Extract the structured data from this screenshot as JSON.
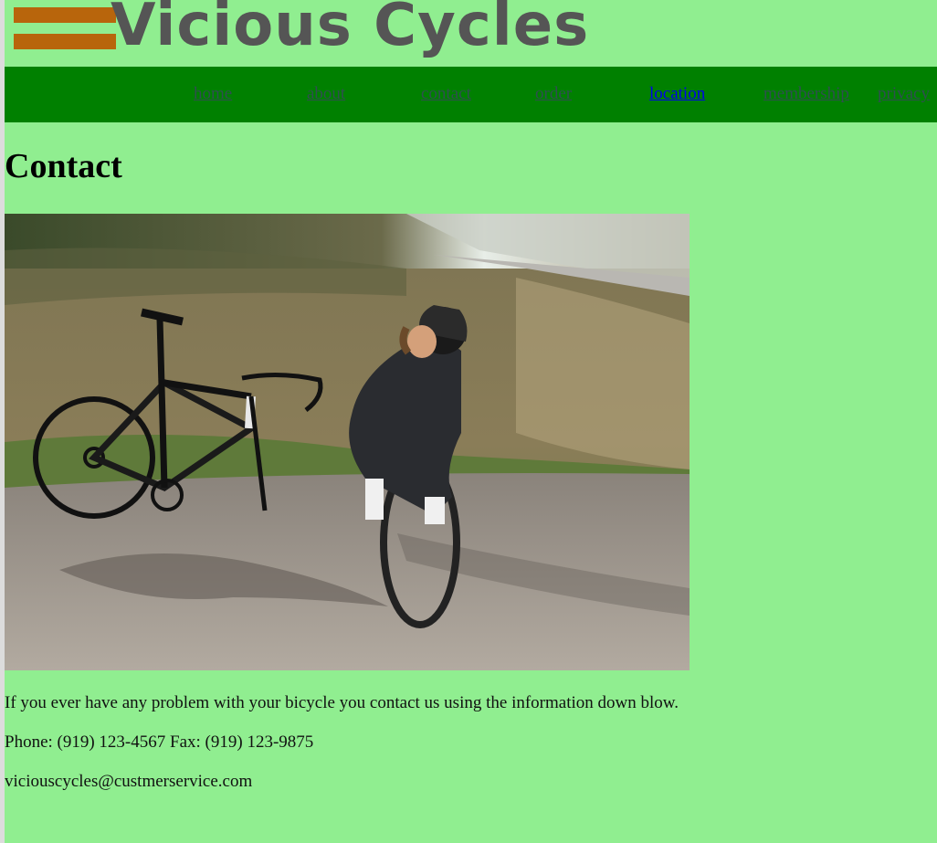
{
  "header": {
    "logo_text": "Vicious Cycles",
    "logo_bar_color": "#b8650c"
  },
  "nav": {
    "items": [
      {
        "label": "home"
      },
      {
        "label": "about"
      },
      {
        "label": "contact"
      },
      {
        "label": "order"
      },
      {
        "label": "location",
        "active": true
      },
      {
        "label": "membership"
      },
      {
        "label": "privacy"
      }
    ]
  },
  "main": {
    "title": "Contact",
    "photo_icon": "cyclist-fixing-wheel-photo",
    "intro": "If you ever have any problem with your bicycle you contact us using the information down blow.",
    "phone_line": "Phone: (919) 123-4567 Fax: (919) 123-9875",
    "email": "viciouscycles@custmerservice.com"
  },
  "colors": {
    "page_bg": "#90ee90",
    "nav_bg": "#008000",
    "nav_link": "#2f4f4f",
    "nav_link_active": "#0000ee"
  }
}
